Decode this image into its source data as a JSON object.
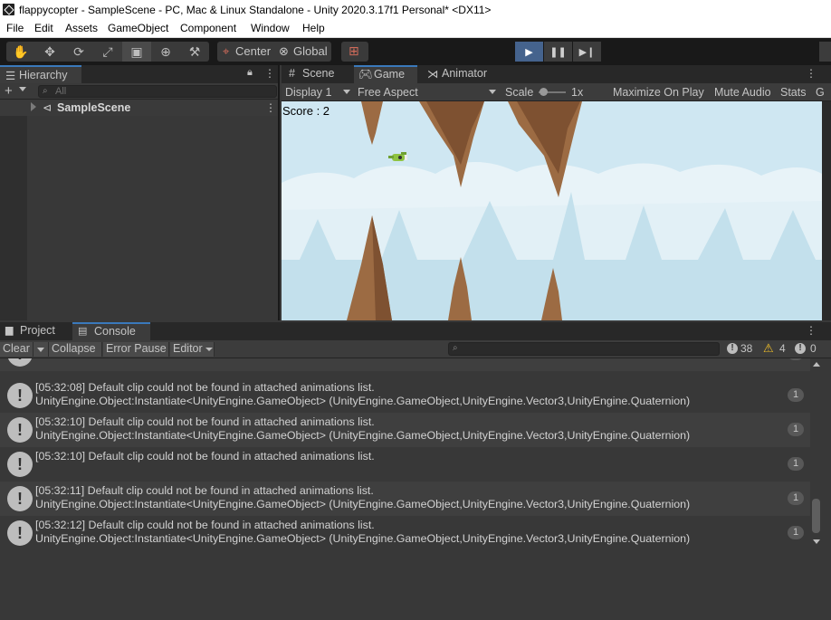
{
  "window": {
    "title": "flappycopter - SampleScene - PC, Mac & Linux Standalone - Unity 2020.3.17f1 Personal* <DX11>"
  },
  "menu": [
    "File",
    "Edit",
    "Assets",
    "GameObject",
    "Component",
    "Window",
    "Help"
  ],
  "toolbar": {
    "pivot_label": "Center",
    "space_label": "Global",
    "play_icon": "play-icon",
    "pause_icon": "pause-icon",
    "step_icon": "step-icon"
  },
  "hierarchy": {
    "tab_label": "Hierarchy",
    "add_label": "+",
    "search_placeholder": "All",
    "scene_name": "SampleScene"
  },
  "game_panel": {
    "tabs": [
      {
        "label": "Scene",
        "icon": "grid-icon"
      },
      {
        "label": "Game",
        "icon": "gamepad-icon"
      },
      {
        "label": "Animator",
        "icon": "animator-icon"
      }
    ],
    "display": "Display 1",
    "aspect": "Free Aspect",
    "scale_label": "Scale",
    "scale_value": "1x",
    "maximize_label": "Maximize On Play",
    "mute_label": "Mute Audio",
    "stats_label": "Stats",
    "gizmos_label": "G",
    "score_text": "Score : 2"
  },
  "bottom_panel": {
    "tabs": [
      {
        "label": "Project",
        "icon": "folder-icon"
      },
      {
        "label": "Console",
        "icon": "console-icon"
      }
    ],
    "clear_label": "Clear",
    "collapse_label": "Collapse",
    "error_pause_label": "Error Pause",
    "editor_label": "Editor",
    "log_count": "38",
    "warning_count": "4",
    "error_count": "0",
    "entries": [
      {
        "line1": "[05:32:08] Default clip could not be found in attached animations list.",
        "line2": "UnityEngine.Object:Instantiate<UnityEngine.GameObject> (UnityEngine.GameObject,UnityEngine.Vector3,UnityEngine.Quaternion)",
        "count": "1"
      },
      {
        "line1": "[05:32:10] Default clip could not be found in attached animations list.",
        "line2": "UnityEngine.Object:Instantiate<UnityEngine.GameObject> (UnityEngine.GameObject,UnityEngine.Vector3,UnityEngine.Quaternion)",
        "count": "1"
      },
      {
        "line1": "[05:32:10] Default clip could not be found in attached animations list.",
        "line2": "",
        "count": "1"
      },
      {
        "line1": "[05:32:11] Default clip could not be found in attached animations list.",
        "line2": "UnityEngine.Object:Instantiate<UnityEngine.GameObject> (UnityEngine.GameObject,UnityEngine.Vector3,UnityEngine.Quaternion)",
        "count": "1"
      },
      {
        "line1": "[05:32:12] Default clip could not be found in attached animations list.",
        "line2": "UnityEngine.Object:Instantiate<UnityEngine.GameObject> (UnityEngine.GameObject,UnityEngine.Vector3,UnityEngine.Quaternion)",
        "count": "1"
      }
    ]
  },
  "colors": {
    "accent": "#3a79bb",
    "play_active": "#45638d",
    "sky": "#cfe7f2",
    "rock": "#9c6b43"
  }
}
